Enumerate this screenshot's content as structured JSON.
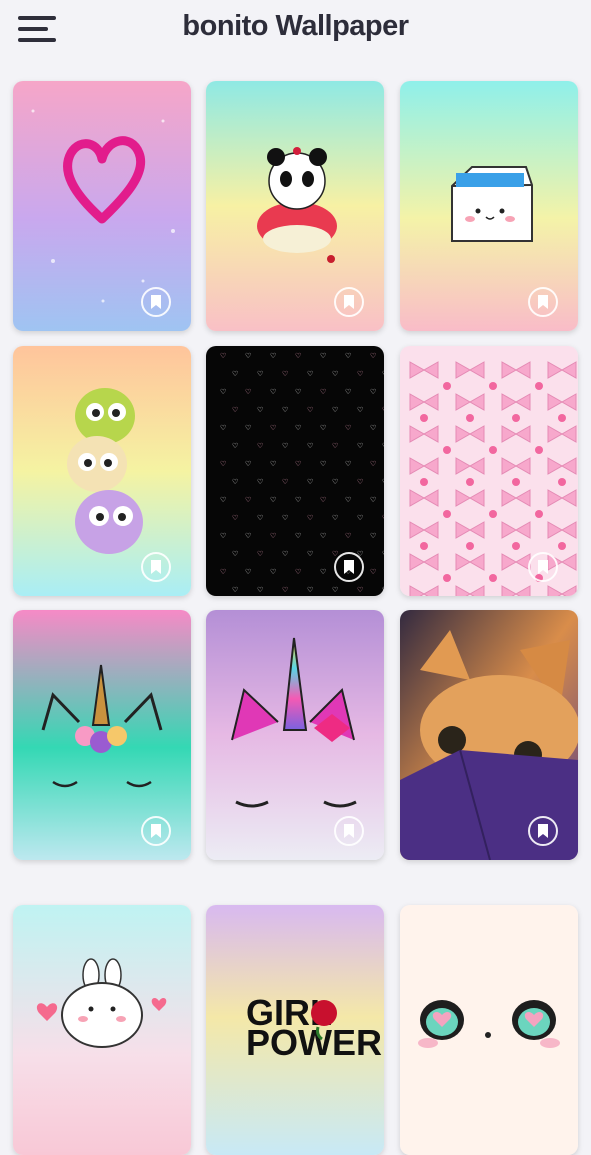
{
  "app_bar": {
    "title": "bonito Wallpaper",
    "menu_icon": "hamburger-menu-icon"
  },
  "wallpapers": [
    {
      "subject": "glitter heart",
      "colors": [
        "#f6a6c8",
        "#c9a8ee",
        "#9fc4f2"
      ]
    },
    {
      "subject": "panda cupcake",
      "colors": [
        "#8fe9e4",
        "#f7f1a4",
        "#f9c0c6"
      ]
    },
    {
      "subject": "milk carton",
      "colors": [
        "#8ff0ea",
        "#f4f3a8",
        "#f9bcc8"
      ]
    },
    {
      "subject": "stacked chicks",
      "colors": [
        "#ffc49c",
        "#f5f3a2",
        "#a9eef5"
      ]
    },
    {
      "subject": "pink hearts on black",
      "colors": [
        "#050505",
        "#0a0a0a",
        "#050505"
      ]
    },
    {
      "subject": "pink bows and crowns",
      "colors": [
        "#fbe0ec",
        "#f9d8e8",
        "#fbe0ec"
      ]
    },
    {
      "subject": "unicorn with flowers",
      "colors": [
        "#f68ac6",
        "#34d8b4",
        "#bde8ef"
      ]
    },
    {
      "subject": "rainbow horn unicorn",
      "colors": [
        "#b48fd6",
        "#e6b9e4",
        "#ececf4"
      ]
    },
    {
      "subject": "orange kitten",
      "colors": [
        "#332a40",
        "#d98d4a",
        "#533b86"
      ]
    },
    {
      "subject": "bunny cupcake",
      "colors": [
        "#bff3f2",
        "#f7dfe9",
        "#f8c8d6"
      ]
    },
    {
      "subject": "girl power rose",
      "text": "GIRL POWER",
      "colors": [
        "#d8b9f0",
        "#f4e8a8",
        "#c8e9f6"
      ]
    },
    {
      "subject": "kawaii face",
      "colors": [
        "#fff3ec",
        "#fff1ea",
        "#fff3ec"
      ]
    }
  ]
}
